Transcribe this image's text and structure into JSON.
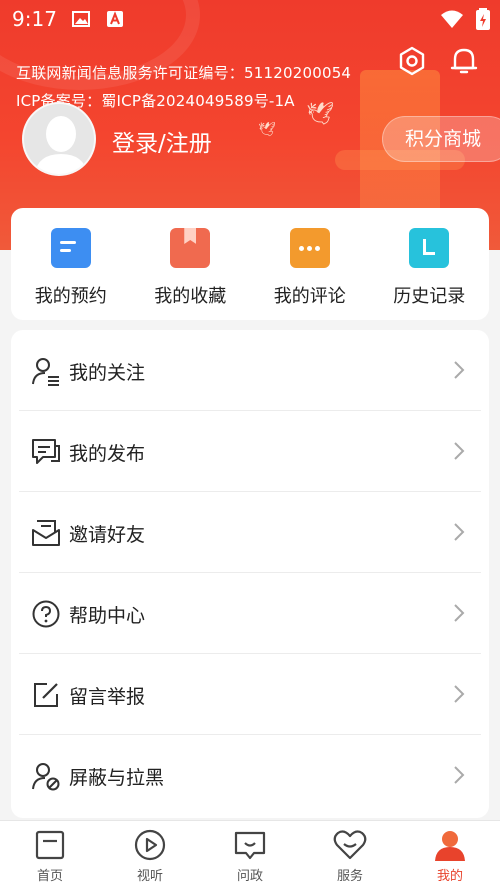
{
  "status_bar": {
    "time": "9:17"
  },
  "header": {
    "license_line1": "互联网新闻信息服务许可证编号：51120200054",
    "license_line2": "ICP备案号：蜀ICP备2024049589号-1A",
    "login_text": "登录/注册",
    "points_button": "积分商城"
  },
  "quick_actions": [
    {
      "label": "我的预约",
      "icon": "calendar-icon",
      "color": "#3d8ef2"
    },
    {
      "label": "我的收藏",
      "icon": "bookmark-icon",
      "color": "#f06a4f"
    },
    {
      "label": "我的评论",
      "icon": "comment-icon",
      "color": "#f39a2d"
    },
    {
      "label": "历史记录",
      "icon": "history-icon",
      "color": "#27c2dc"
    }
  ],
  "menu": [
    {
      "label": "我的关注",
      "icon": "follow-icon"
    },
    {
      "label": "我的发布",
      "icon": "publish-icon"
    },
    {
      "label": "邀请好友",
      "icon": "invite-icon"
    },
    {
      "label": "帮助中心",
      "icon": "help-icon"
    },
    {
      "label": "留言举报",
      "icon": "report-icon"
    },
    {
      "label": "屏蔽与拉黑",
      "icon": "block-icon"
    }
  ],
  "bottom_nav": [
    {
      "label": "首页",
      "icon": "home-icon"
    },
    {
      "label": "视听",
      "icon": "play-icon"
    },
    {
      "label": "问政",
      "icon": "chat-icon"
    },
    {
      "label": "服务",
      "icon": "heart-icon"
    },
    {
      "label": "我的",
      "icon": "profile-icon",
      "active": true
    }
  ],
  "colors": {
    "brand": "#ef3b2c",
    "active_nav": "#e8432c"
  }
}
